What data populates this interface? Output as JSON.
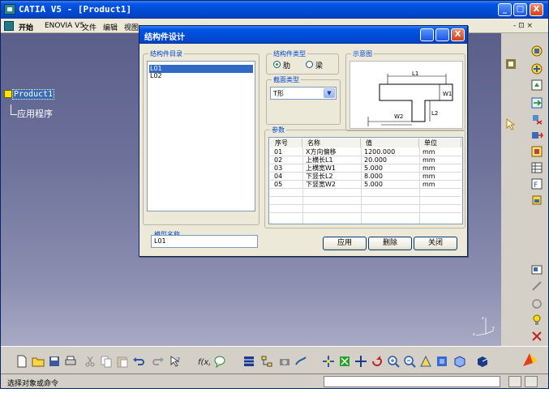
{
  "window": {
    "title": "CATIA V5 - [Product1]",
    "min": "_",
    "max": "□",
    "close": "X"
  },
  "menu": {
    "items": [
      "开始",
      "ENOVIA V5",
      "文件",
      "编辑",
      "视图"
    ],
    "right": "- ⊡ ×"
  },
  "tree": {
    "root": "Product1",
    "child": "应用程序"
  },
  "dialog": {
    "title": "结构件设计",
    "catalog": {
      "label": "结构件目录",
      "items": [
        "L01",
        "L02"
      ],
      "selected": "L01"
    },
    "struct_type": {
      "label": "结构件类型",
      "options": [
        "肋",
        "梁"
      ],
      "selected": "肋"
    },
    "section_type": {
      "label": "截面类型",
      "value": "T形"
    },
    "schematic": {
      "label": "示意图",
      "labels": {
        "l1": "L1",
        "w1": "W1",
        "w2": "W2",
        "l2": "L2"
      }
    },
    "params": {
      "label": "参数",
      "headers": [
        "序号",
        "名称",
        "值",
        "单位"
      ],
      "rows": [
        [
          "01",
          "X方向偏移",
          "1200.000",
          "mm"
        ],
        [
          "02",
          "上横长L1",
          "20.000",
          "mm"
        ],
        [
          "03",
          "上横宽W1",
          "5.000",
          "mm"
        ],
        [
          "04",
          "下竖长L2",
          "8.000",
          "mm"
        ],
        [
          "05",
          "下竖宽W2",
          "5.000",
          "mm"
        ]
      ]
    },
    "model_name": {
      "label": "模型名称",
      "value": "L01"
    },
    "buttons": {
      "apply": "应用",
      "delete": "删除",
      "close": "关闭"
    }
  },
  "status": {
    "text": "选择对象或命令"
  },
  "colors": {
    "title_blue": "#0055e5",
    "viewport_top": "#5a5f8a",
    "viewport_bottom": "#a8aac4",
    "selection": "#316ac5",
    "group_label": "#0046d5"
  },
  "icons": {
    "right": [
      "product-icon",
      "scale-icon",
      "assembly-icon",
      "update-icon",
      "constraint-icon",
      "snap-icon",
      "explode-icon",
      "catalog-icon",
      "table-icon",
      "knowledge-icon",
      "measure-icon",
      "hide-show-icon",
      "swap-icon",
      "light-icon",
      "cut-icon"
    ],
    "bottom": [
      "new-icon",
      "open-icon",
      "save-icon",
      "print-icon",
      "cut-icon",
      "copy-icon",
      "paste-icon",
      "undo-icon",
      "redo-icon",
      "whats-this-icon",
      "formula-icon",
      "comment-icon",
      "table-icon",
      "tree-icon",
      "fly-icon",
      "pan-icon",
      "rotate-icon",
      "zoom-in-icon",
      "zoom-out-icon",
      "normal-view-icon",
      "isometric-icon",
      "render-icon"
    ]
  }
}
